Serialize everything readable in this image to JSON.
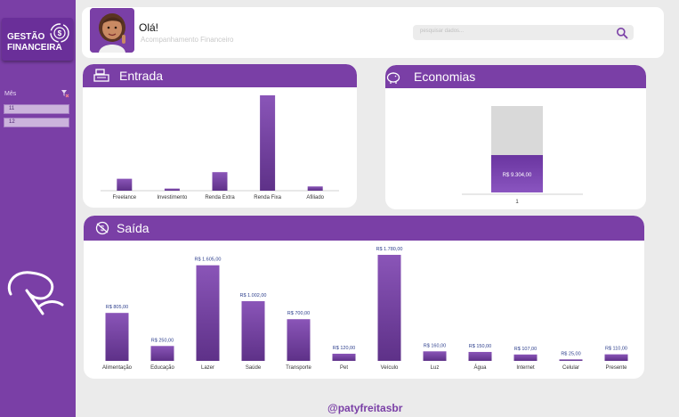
{
  "app": {
    "logo_line1": "GESTÃO",
    "logo_line2": "FINANCEIRA",
    "accent_color": "#7a3fa6"
  },
  "header": {
    "greeting": "Olá!",
    "subtitle": "Acompanhamento Financeiro",
    "search_placeholder": "pesquisar dados..."
  },
  "sidebar": {
    "filter_label": "Mês",
    "months": [
      "11",
      "12"
    ]
  },
  "footer": {
    "handle": "@patyfreitasbr"
  },
  "chart_data": [
    {
      "title": "Entrada",
      "type": "bar",
      "categories": [
        "Freelance",
        "Investimento",
        "Renda Extra",
        "Renda Fixa",
        "Afiliado"
      ],
      "values": [
        450,
        80,
        700,
        3600,
        160
      ],
      "ylim": [
        0,
        3700
      ],
      "data_labels": false
    },
    {
      "title": "Economias",
      "type": "bar",
      "categories": [
        "1"
      ],
      "values": [
        9304
      ],
      "value_labels": [
        "R$ 9.304,00"
      ],
      "ylim": [
        0,
        21500
      ],
      "background_bar": true
    },
    {
      "title": "Saída",
      "type": "bar",
      "categories": [
        "Alimentação",
        "Educação",
        "Lazer",
        "Saúde",
        "Transporte",
        "Pet",
        "Veículo",
        "Luz",
        "Água",
        "Internet",
        "Celular",
        "Presente"
      ],
      "values": [
        805,
        250,
        1605,
        1002,
        700,
        120,
        1780,
        160,
        150,
        107,
        25,
        110
      ],
      "value_labels": [
        "R$ 805,00",
        "R$ 250,00",
        "R$ 1.605,00",
        "R$ 1.002,00",
        "R$ 700,00",
        "R$ 120,00",
        "R$ 1.780,00",
        "R$ 160,00",
        "R$ 150,00",
        "R$ 107,00",
        "R$ 25,00",
        "R$ 110,00"
      ],
      "ylim": [
        0,
        1900
      ]
    }
  ]
}
